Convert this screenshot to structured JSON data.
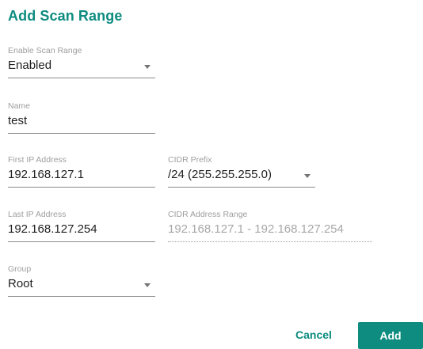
{
  "dialog": {
    "title": "Add Scan Range"
  },
  "fields": {
    "enable_scan_range": {
      "label": "Enable Scan Range",
      "value": "Enabled"
    },
    "name": {
      "label": "Name",
      "value": "test"
    },
    "first_ip": {
      "label": "First IP Address",
      "value": "192.168.127.1"
    },
    "cidr_prefix": {
      "label": "CIDR Prefix",
      "value": "/24 (255.255.255.0)"
    },
    "last_ip": {
      "label": "Last IP Address",
      "value": "192.168.127.254"
    },
    "cidr_range": {
      "label": "CIDR Address Range",
      "value": "192.168.127.1 - 192.168.127.254"
    },
    "group": {
      "label": "Group",
      "value": "Root"
    }
  },
  "actions": {
    "cancel_label": "Cancel",
    "add_label": "Add"
  },
  "colors": {
    "accent": "#0d8c7f"
  }
}
